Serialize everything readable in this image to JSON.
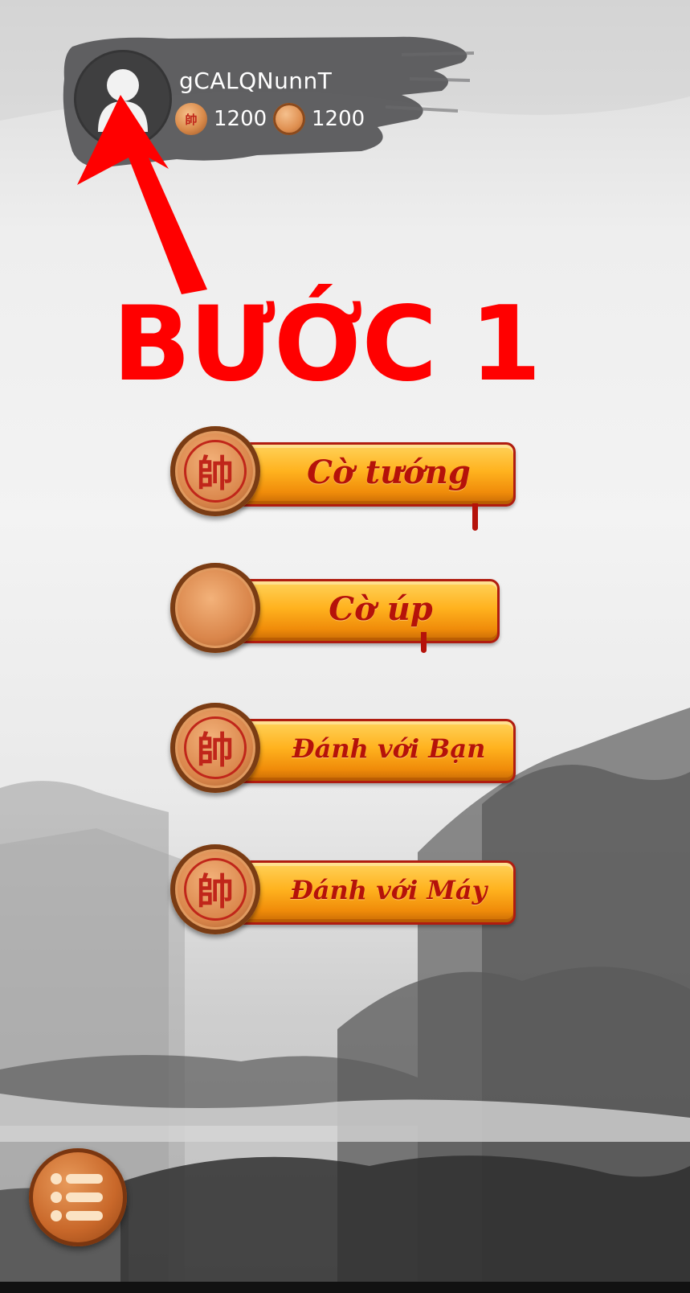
{
  "profile": {
    "username": "gCALQNunnT",
    "currencies": [
      {
        "icon": "general-piece-coin-icon",
        "amount": "1200"
      },
      {
        "icon": "plain-coin-icon",
        "amount": "1200"
      }
    ]
  },
  "annotation": {
    "step_label": "BƯỚC 1",
    "color": "#ff0000"
  },
  "menu": {
    "items": [
      {
        "label": "Cờ tướng",
        "piece_char": "帥"
      },
      {
        "label": "Cờ úp",
        "piece_char": ""
      },
      {
        "label": "Đánh với Bạn",
        "piece_char": "帥"
      },
      {
        "label": "Đánh với Máy",
        "piece_char": "帥"
      }
    ]
  },
  "settings": {
    "icon": "menu-list-icon"
  },
  "colors": {
    "button_orange": "#ffb21e",
    "label_red": "#b5120a",
    "piece_wood": "#d9854a"
  }
}
